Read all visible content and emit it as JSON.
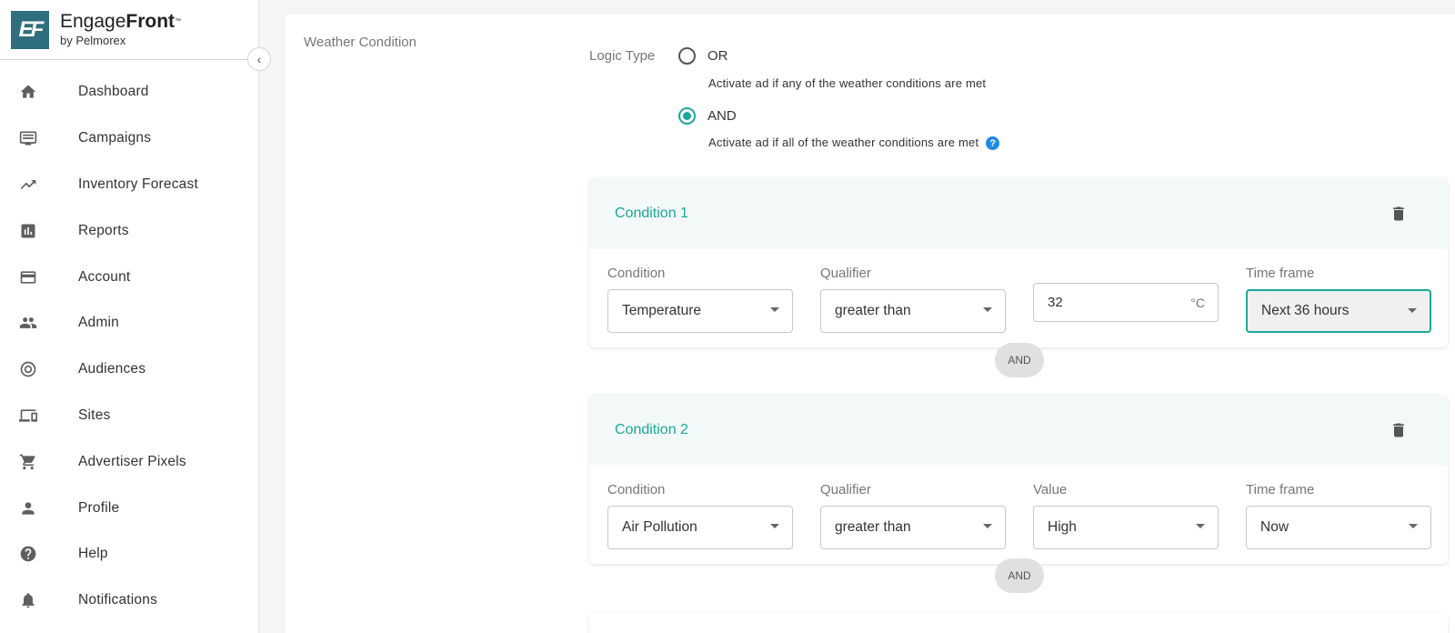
{
  "app": {
    "name_light": "Engage",
    "name_bold": "Front",
    "trademark": "™",
    "byline": "by Pelmorex",
    "logo_text": "EF"
  },
  "sidebar": {
    "items": [
      {
        "label": "Dashboard",
        "icon": "home-icon"
      },
      {
        "label": "Campaigns",
        "icon": "campaigns-icon"
      },
      {
        "label": "Inventory Forecast",
        "icon": "trending-up-icon"
      },
      {
        "label": "Reports",
        "icon": "bar-chart-icon"
      },
      {
        "label": "Account",
        "icon": "credit-card-icon"
      },
      {
        "label": "Admin",
        "icon": "people-icon"
      },
      {
        "label": "Audiences",
        "icon": "target-icon"
      },
      {
        "label": "Sites",
        "icon": "devices-icon"
      },
      {
        "label": "Advertiser Pixels",
        "icon": "cart-icon"
      },
      {
        "label": "Profile",
        "icon": "person-icon"
      },
      {
        "label": "Help",
        "icon": "help-icon"
      },
      {
        "label": "Notifications",
        "icon": "bell-icon"
      }
    ]
  },
  "form": {
    "section_label": "Weather Condition",
    "logic_label": "Logic Type",
    "options": [
      {
        "label": "OR",
        "desc": "Activate ad if any of the weather conditions are met",
        "checked": false
      },
      {
        "label": "AND",
        "desc": "Activate ad if all of the weather conditions are met",
        "checked": true
      }
    ],
    "help_glyph": "?",
    "conditions": [
      {
        "title": "Condition 1",
        "condition_label": "Condition",
        "condition": "Temperature",
        "qualifier_label": "Qualifier",
        "qualifier": "greater than",
        "value_label": "",
        "value": "32",
        "unit": "°C",
        "timeframe_label": "Time frame",
        "timeframe": "Next 36 hours"
      },
      {
        "title": "Condition 2",
        "condition_label": "Condition",
        "condition": "Air Pollution",
        "qualifier_label": "Qualifier",
        "qualifier": "greater than",
        "value_label": "Value",
        "value": "High",
        "timeframe_label": "Time frame",
        "timeframe": "Now"
      }
    ],
    "joiner": "AND"
  },
  "colors": {
    "accent": "#1aa89a",
    "logo": "#2e6e7e",
    "help": "#1e88e5"
  }
}
